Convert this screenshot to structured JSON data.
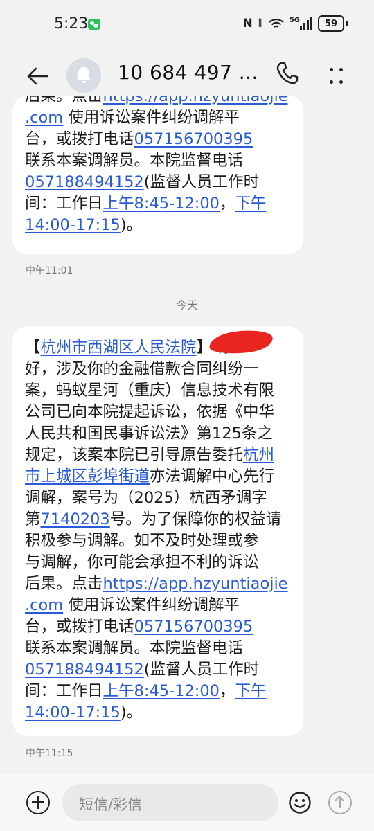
{
  "status_bar": {
    "time": "5:23",
    "battery": "59",
    "network": "5G"
  },
  "header": {
    "title": "10 684 497 ..."
  },
  "messages": [
    {
      "lines": [
        [
          {
            "t": "后果。点击"
          },
          {
            "t": "https://app.hzyuntiaojie",
            "link": true
          }
        ],
        [
          {
            "t": ".com",
            "link": true
          },
          {
            "t": " 使用诉讼案件纠纷调解平"
          }
        ],
        [
          {
            "t": "台，或拨打电话"
          },
          {
            "t": "057156700395",
            "link": true
          }
        ],
        [
          {
            "t": "联系本案调解员。本院监督电话"
          }
        ],
        [
          {
            "t": "057188494152",
            "link": true
          },
          {
            "t": "(监督人员工作时"
          }
        ],
        [
          {
            "t": "间：工作日"
          },
          {
            "t": "上午8:45-12:00",
            "link": true
          },
          {
            "t": "，"
          },
          {
            "t": "下午",
            "link": true
          }
        ],
        [
          {
            "t": "14:00-17:15",
            "link": true
          },
          {
            "t": ")。"
          }
        ]
      ],
      "time": "中午11:01"
    },
    {
      "lines": [
        [
          {
            "t": "【"
          },
          {
            "t": "杭州市西湖区人民法院",
            "link": true
          },
          {
            "t": "】"
          },
          {
            "t": "                 你"
          }
        ],
        [
          {
            "t": "好，涉及你的金融借款合同纠纷一"
          }
        ],
        [
          {
            "t": "案，蚂蚁星河（重庆）信息技术有限"
          }
        ],
        [
          {
            "t": "公司已向本院提起诉讼，依据《中华"
          }
        ],
        [
          {
            "t": "人民共和国民事诉讼法》第125条之"
          }
        ],
        [
          {
            "t": "规定，该案本院已引导原告委托"
          },
          {
            "t": "杭州",
            "link": true
          }
        ],
        [
          {
            "t": "市上城区彭埠街道",
            "link": true
          },
          {
            "t": "亦法调解中心先行"
          }
        ],
        [
          {
            "t": "调解，案号为（2025）杭西矛调字"
          }
        ],
        [
          {
            "t": "第"
          },
          {
            "t": "7140203",
            "link": true
          },
          {
            "t": "号。为了保障你的权益请"
          }
        ],
        [
          {
            "t": "积极参与调解。如不及时处理或参"
          }
        ],
        [
          {
            "t": "与调解，你可能会承担不利的诉讼"
          }
        ],
        [
          {
            "t": "后果。点击"
          },
          {
            "t": "https://app.hzyuntiaojie",
            "link": true
          }
        ],
        [
          {
            "t": ".com",
            "link": true
          },
          {
            "t": " 使用诉讼案件纠纷调解平"
          }
        ],
        [
          {
            "t": "台，或拨打电话"
          },
          {
            "t": "057156700395",
            "link": true
          }
        ],
        [
          {
            "t": "联系本案调解员。本院监督电话"
          }
        ],
        [
          {
            "t": "057188494152",
            "link": true
          },
          {
            "t": "(监督人员工作时"
          }
        ],
        [
          {
            "t": "间：工作日"
          },
          {
            "t": "上午8:45-12:00",
            "link": true
          },
          {
            "t": "，"
          },
          {
            "t": "下午",
            "link": true
          }
        ],
        [
          {
            "t": "14:00-17:15",
            "link": true
          },
          {
            "t": ")。"
          }
        ]
      ],
      "time": "中午11:15"
    }
  ],
  "day_divider": "今天",
  "input": {
    "placeholder": "短信/彩信"
  },
  "colors": {
    "link": "#2a5bd7",
    "background": "#f2f2f2",
    "bubble": "#ffffff",
    "redaction": "#e8261f"
  },
  "icons": [
    "back-arrow-icon",
    "bell-icon",
    "phone-icon",
    "more-dots-icon",
    "add-icon",
    "emoji-icon",
    "send-icon",
    "wechat-icon",
    "wifi-icon",
    "signal-icon",
    "battery-icon"
  ]
}
